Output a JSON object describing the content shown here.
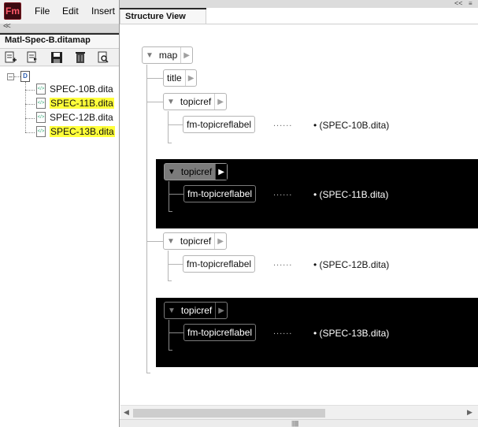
{
  "app": {
    "logo": "Fm"
  },
  "menu": {
    "file": "File",
    "edit": "Edit",
    "insert": "Insert"
  },
  "left_panel": {
    "collapse": "<<",
    "tab_title": "Matl-Spec-B.ditamap",
    "toolbar_icons": [
      "new-topic-icon",
      "insert-topic-icon",
      "save-icon",
      "delete-icon",
      "preview-icon"
    ],
    "files": [
      {
        "name": "SPEC-10B.dita",
        "highlighted": false
      },
      {
        "name": "SPEC-11B.dita",
        "highlighted": true
      },
      {
        "name": "SPEC-12B.dita",
        "highlighted": false
      },
      {
        "name": "SPEC-13B.dita",
        "highlighted": true
      }
    ],
    "highlight_color": "#ffff3a"
  },
  "right_panel": {
    "collapse": "<<",
    "tab_title": "Structure View",
    "tree": {
      "root": "map",
      "title": "title",
      "topicrefs": [
        {
          "element": "topicref",
          "child": "fm-topicreflabel",
          "dots": "......",
          "ref": "• (SPEC-10B.dita)",
          "dark": false
        },
        {
          "element": "topicref",
          "child": "fm-topicreflabel",
          "dots": "......",
          "ref": "• (SPEC-11B.dita)",
          "dark": true
        },
        {
          "element": "topicref",
          "child": "fm-topicreflabel",
          "dots": "......",
          "ref": "• (SPEC-12B.dita)",
          "dark": false
        },
        {
          "element": "topicref",
          "child": "fm-topicreflabel",
          "dots": "......",
          "ref": "• (SPEC-13B.dita)",
          "dark": true
        }
      ]
    }
  },
  "colors": {
    "dark_block": "#000000",
    "selected_node": "#7b7b7b"
  }
}
